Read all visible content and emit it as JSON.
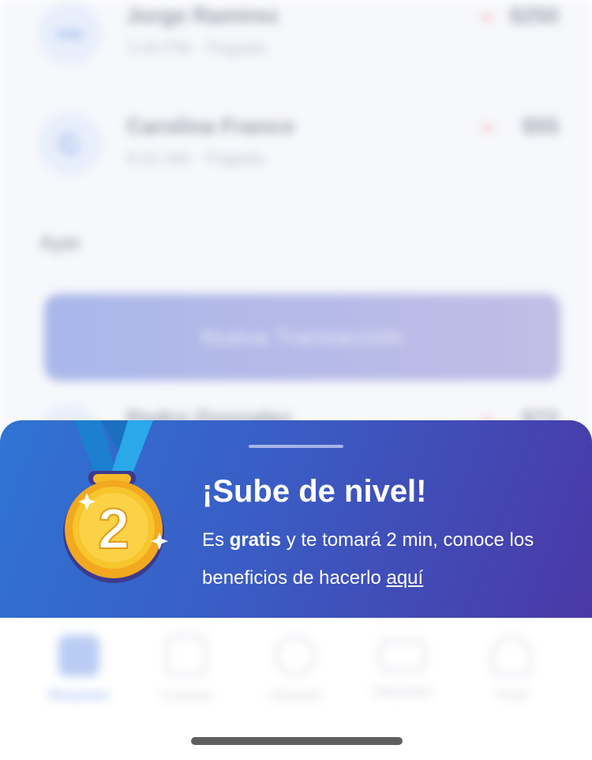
{
  "transactions": [
    {
      "name": "Jorge Ramirez",
      "subtitle": "3:40 PM · Pagado",
      "amount": "$250",
      "avatar": "swap"
    },
    {
      "name": "Carolina Franco",
      "subtitle": "8:42 AM · Pagado",
      "amount": "$55",
      "avatar": "refresh-icon"
    },
    {
      "name": "Pedro Gonzalez",
      "amount": "$72"
    }
  ],
  "section_label": "Ayer",
  "new_transaction_button": "Nueva Transacción",
  "tabs": [
    {
      "label": "Resumen",
      "icon": "wallet-icon",
      "active": true
    },
    {
      "label": "Cuentas",
      "icon": "grid-icon",
      "active": false
    },
    {
      "label": "Historial",
      "icon": "clock-icon",
      "active": false
    },
    {
      "label": "Depositar",
      "icon": "card-icon",
      "active": false
    },
    {
      "label": "Perfil",
      "icon": "user-icon",
      "active": false
    }
  ],
  "banner": {
    "title": "¡Sube de nivel!",
    "text_before": "Es ",
    "text_bold": "gratis",
    "text_after": " y te tomará 2 min, conoce los beneficios de hacerlo ",
    "link_text": "aquí",
    "medal_number": "2"
  },
  "colors": {
    "banner_start": "#2f74d4",
    "banner_end": "#4a38a6",
    "medal_gold": "#f7c52c",
    "ribbon": "#2a9be0"
  }
}
